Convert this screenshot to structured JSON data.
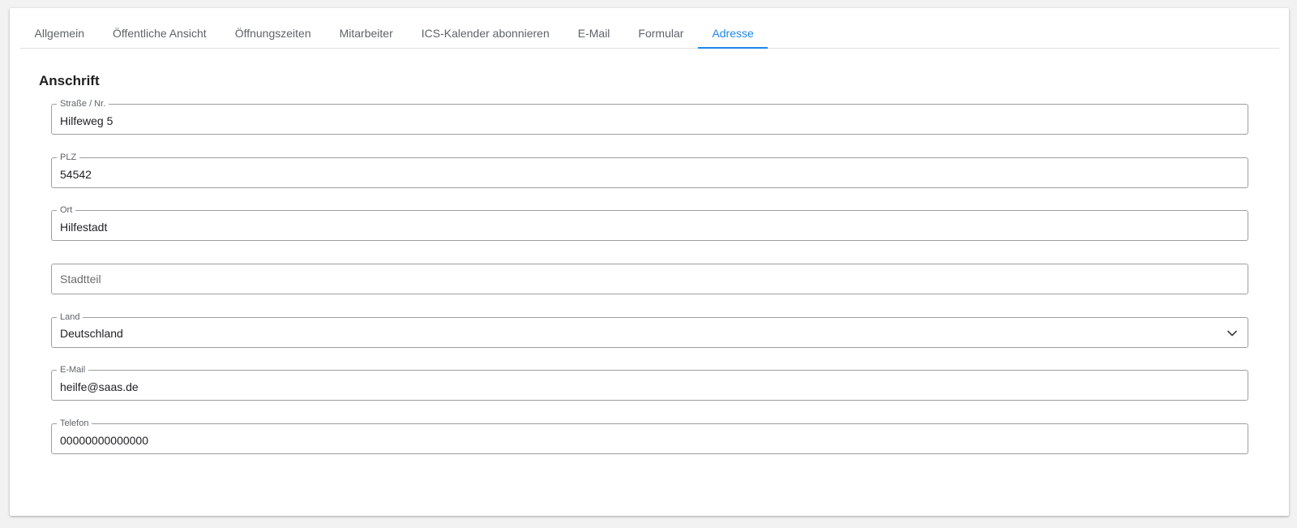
{
  "tabs": [
    {
      "label": "Allgemein",
      "active": false
    },
    {
      "label": "Öffentliche Ansicht",
      "active": false
    },
    {
      "label": "Öffnungszeiten",
      "active": false
    },
    {
      "label": "Mitarbeiter",
      "active": false
    },
    {
      "label": "ICS-Kalender abonnieren",
      "active": false
    },
    {
      "label": "E-Mail",
      "active": false
    },
    {
      "label": "Formular",
      "active": false
    },
    {
      "label": "Adresse",
      "active": true
    }
  ],
  "accent_color": "#1e88e5",
  "section": {
    "title": "Anschrift"
  },
  "form": {
    "street": {
      "label": "Straße / Nr.",
      "value": "Hilfeweg 5"
    },
    "zip": {
      "label": "PLZ",
      "value": "54542"
    },
    "city": {
      "label": "Ort",
      "value": "Hilfestadt"
    },
    "district": {
      "placeholder": "Stadtteil",
      "value": ""
    },
    "country": {
      "label": "Land",
      "value": "Deutschland",
      "icon": "chevron-down-icon"
    },
    "email": {
      "label": "E-Mail",
      "value": "heilfe@saas.de"
    },
    "phone": {
      "label": "Telefon",
      "value": "00000000000000"
    }
  }
}
